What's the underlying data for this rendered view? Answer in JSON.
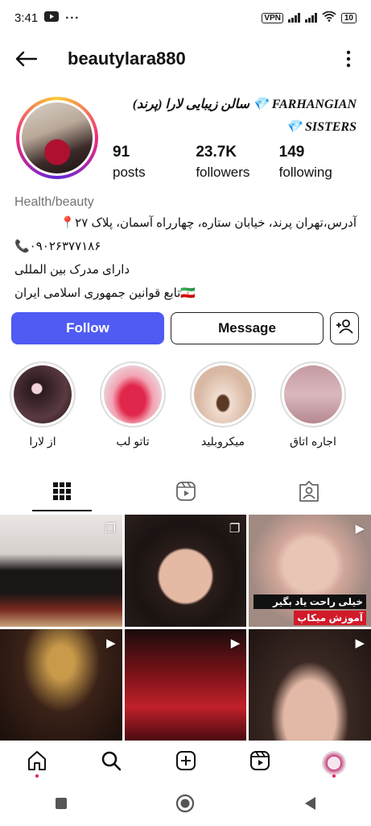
{
  "status": {
    "time": "3:41",
    "vpn": "VPN",
    "battery": "10"
  },
  "header": {
    "username": "beautylara880"
  },
  "profile": {
    "fullname_line1": "سالن زیبایی لارا (پرند) 💎 FARHANGIAN",
    "fullname_line2": "💎 SISTERS",
    "stats": [
      {
        "num": "91",
        "label": "posts"
      },
      {
        "num": "23.7K",
        "label": "followers"
      },
      {
        "num": "149",
        "label": "following"
      }
    ],
    "category": "Health/beauty",
    "bio": [
      "آدرس،تهران پرند، خیابان ستاره، چهارراه آسمان، پلاک ۲۷📍",
      "📞۰۹۰۲۶۳۷۷۱۸۶",
      "دارای مدرک بین المللی",
      "تابع قوانین جمهوری اسلامی ایران🇮🇷"
    ]
  },
  "actions": {
    "follow": "Follow",
    "message": "Message"
  },
  "highlights": [
    {
      "label": "از لارا"
    },
    {
      "label": "تاتو لب"
    },
    {
      "label": "میکروبلید"
    },
    {
      "label": "اجاره اتاق"
    }
  ],
  "posts": [
    {
      "caption": ""
    },
    {
      "caption": ""
    },
    {
      "caption1": "خیلی راحت یاد بگیر",
      "caption2": "آموزش میکاپ"
    },
    {
      "caption": ""
    },
    {
      "caption": ""
    },
    {
      "caption": ""
    }
  ],
  "colors": {
    "accent": "#4f5bf2"
  }
}
